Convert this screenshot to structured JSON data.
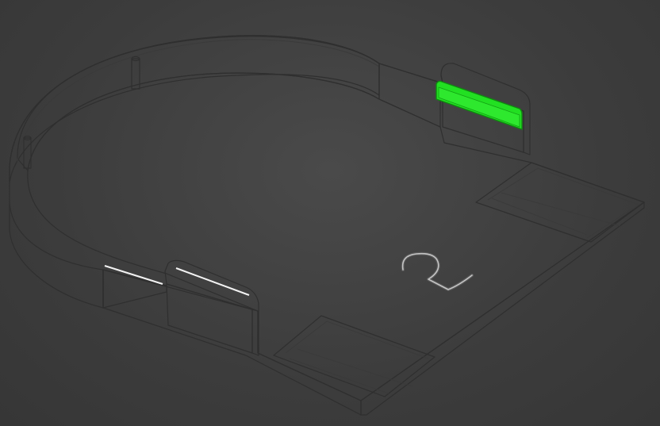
{
  "viewport": {
    "background_color": "#404040",
    "part_face_color": "#a6a6a6",
    "part_wall_color": "#8c8c8c",
    "selection_color": "#22e022",
    "edge_color": "#2f2f2f"
  },
  "model": {
    "embossed_number": "2",
    "selected_face": "tab-face-highlighted",
    "icons": [
      "cad-part-3d",
      "selection-highlight"
    ]
  }
}
